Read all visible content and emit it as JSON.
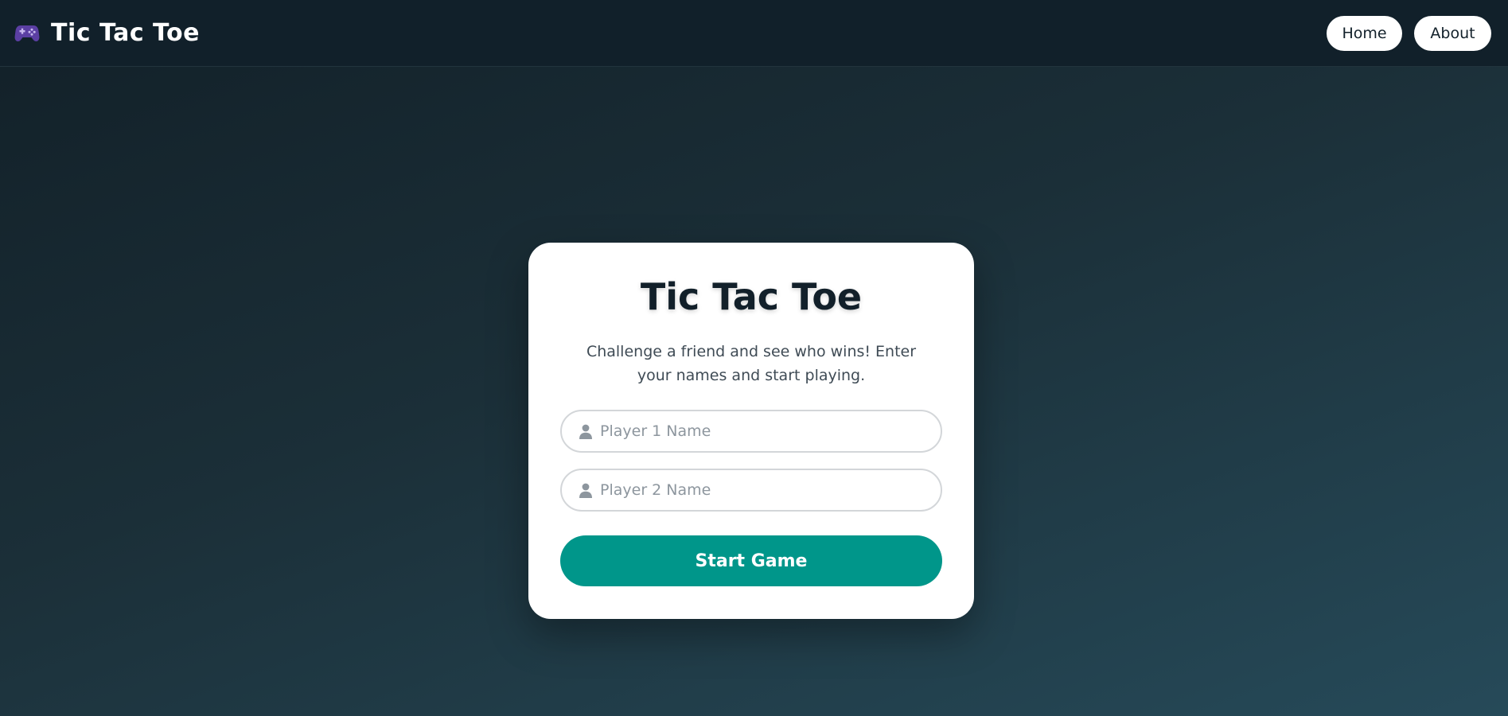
{
  "header": {
    "brand_icon": "gamepad-icon",
    "brand_title": "Tic Tac Toe",
    "nav": {
      "home_label": "Home",
      "about_label": "About"
    }
  },
  "card": {
    "title": "Tic Tac Toe",
    "description": "Challenge a friend and see who wins! Enter your names and start playing.",
    "player1": {
      "icon": "user-icon",
      "value": "",
      "placeholder": "Player 1 Name"
    },
    "player2": {
      "icon": "user-icon",
      "value": "",
      "placeholder": "Player 2 Name"
    },
    "start_label": "Start Game"
  },
  "colors": {
    "header_bg": "#11202a",
    "accent": "#00968a",
    "brand_icon": "#6a4bb3",
    "text_dark": "#12202a"
  }
}
